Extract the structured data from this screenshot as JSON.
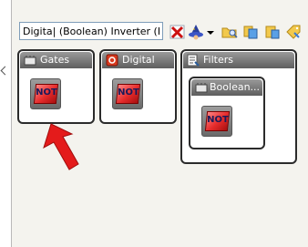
{
  "search": {
    "value": "Digita| (Boolean) Inverter (Not)"
  },
  "toolbar": {
    "icons": [
      "clear-search-icon",
      "wizard-icon",
      "dropdown-arrow-icon",
      "folder-search-icon",
      "copy-icon",
      "paste-icon",
      "tag-icon"
    ]
  },
  "categories": [
    {
      "label": "Gates",
      "icon": "gates-icon",
      "item": "NOT"
    },
    {
      "label": "Digital",
      "icon": "digital-icon",
      "item": "NOT"
    },
    {
      "label": "Filters",
      "icon": "filters-icon",
      "subcategory": {
        "label": "Boolean...",
        "icon": "boolean-icon",
        "item": "NOT"
      }
    }
  ],
  "colors": {
    "header_gradient_top": "#9a9a9a",
    "header_gradient_bottom": "#5e5e5e",
    "panel_border": "#2b2b2b",
    "arrow": "#e41b1b",
    "not_tile_red": "#e52b2b"
  }
}
